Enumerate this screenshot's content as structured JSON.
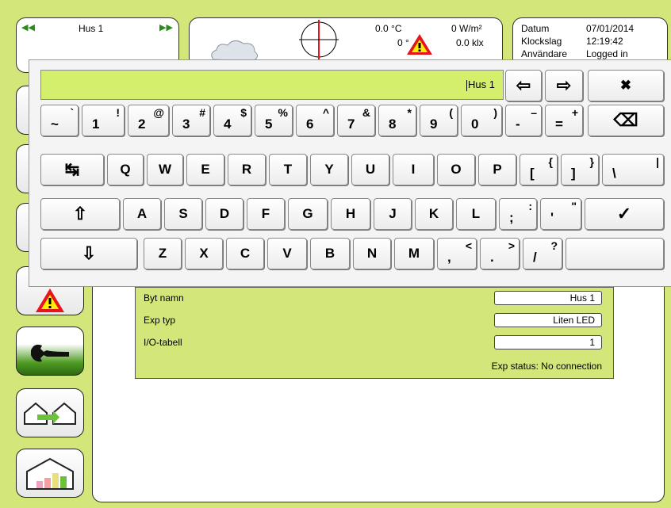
{
  "header": {
    "house_name": "Hus 1",
    "temp_1": "0.0 °C",
    "temp_2": "0 °",
    "radiation": "0 W/m²",
    "light": "0.0 klx",
    "datum_label": "Datum",
    "datum_value": "07/01/2014",
    "klockslag_label": "Klockslag",
    "klockslag_value": "12:19:42",
    "anvandare_label": "Användare",
    "anvandare_value": "Logged in"
  },
  "keyboard": {
    "input_value": "Hus 1",
    "row1": [
      {
        "main": "~",
        "shift": "`"
      },
      {
        "main": "1",
        "shift": "!"
      },
      {
        "main": "2",
        "shift": "@"
      },
      {
        "main": "3",
        "shift": "#"
      },
      {
        "main": "4",
        "shift": "$"
      },
      {
        "main": "5",
        "shift": "%"
      },
      {
        "main": "6",
        "shift": "^"
      },
      {
        "main": "7",
        "shift": "&"
      },
      {
        "main": "8",
        "shift": "*"
      },
      {
        "main": "9",
        "shift": "("
      },
      {
        "main": "0",
        "shift": ")"
      },
      {
        "main": "-",
        "shift": "–"
      },
      {
        "main": "=",
        "shift": "+"
      }
    ],
    "row2": [
      "Q",
      "W",
      "E",
      "R",
      "T",
      "Y",
      "U",
      "I",
      "O",
      "P"
    ],
    "row2_extra": [
      {
        "main": "[",
        "shift": "{"
      },
      {
        "main": "]",
        "shift": "}"
      },
      {
        "main": "\\",
        "shift": "|"
      }
    ],
    "row3": [
      "A",
      "S",
      "D",
      "F",
      "G",
      "H",
      "J",
      "K",
      "L"
    ],
    "row3_extra": [
      {
        "main": ";",
        "shift": ":"
      },
      {
        "main": "'",
        "shift": "\""
      }
    ],
    "row4": [
      "Z",
      "X",
      "C",
      "V",
      "B",
      "N",
      "M"
    ],
    "row4_extra": [
      {
        "main": ",",
        "shift": "<"
      },
      {
        "main": ".",
        "shift": ">"
      },
      {
        "main": "/",
        "shift": "?"
      }
    ],
    "icons": {
      "left": "⇦",
      "right": "⇨",
      "close": "✖",
      "backspace": "⌫",
      "tab": "↹",
      "shift": "⇧",
      "enter": "✓",
      "down": "⇩"
    }
  },
  "form": {
    "byt_namn_label": "Byt namn",
    "byt_namn_value": "Hus 1",
    "exp_typ_label": "Exp typ",
    "exp_typ_value": "Liten LED",
    "io_label": "I/O-tabell",
    "io_value": "1",
    "status": "Exp status: No connection"
  },
  "colors": {
    "background": "#d3e67a",
    "input_bar": "#d3ef6b",
    "alarm_red": "#e8141c",
    "alarm_yellow": "#ffee00",
    "tool_green": "#4e9a22"
  }
}
